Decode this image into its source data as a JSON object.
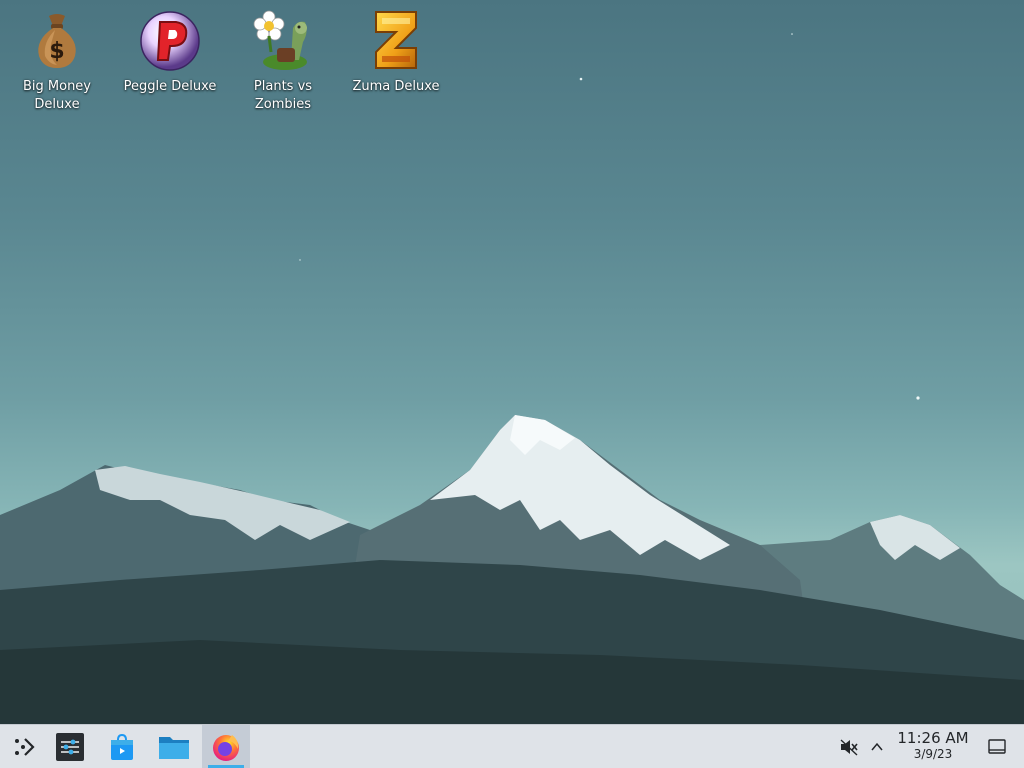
{
  "desktop": {
    "icons": [
      {
        "label": "Big Money\nDeluxe",
        "icon": "money-bag-icon"
      },
      {
        "label": "Peggle Deluxe",
        "icon": "peggle-icon"
      },
      {
        "label": "Plants vs\nZombies",
        "icon": "plants-vs-zombies-icon"
      },
      {
        "label": "Zuma Deluxe",
        "icon": "zuma-icon"
      }
    ]
  },
  "taskbar": {
    "launcher_icon": "application-launcher-icon",
    "pinned": [
      {
        "name": "system-settings-icon"
      },
      {
        "name": "discover-store-icon"
      },
      {
        "name": "file-manager-icon"
      },
      {
        "name": "firefox-icon",
        "active": true
      }
    ],
    "tray": {
      "volume_icon": "volume-muted-icon",
      "expand_icon": "chevron-up-icon",
      "time": "11:26 AM",
      "date": "3/9/23",
      "show_desktop_icon": "show-desktop-icon"
    },
    "accent_color": "#3daee9"
  }
}
